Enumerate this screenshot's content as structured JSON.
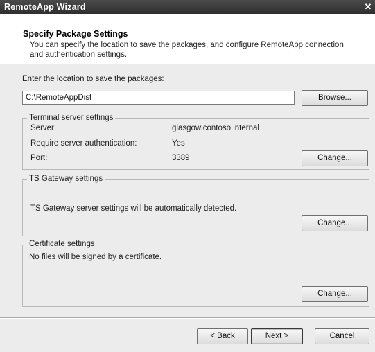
{
  "window": {
    "title": "RemoteApp Wizard",
    "close_glyph": "✕"
  },
  "header": {
    "title": "Specify Package Settings",
    "description": "You can specify the location to save the packages, and configure RemoteApp connection and authentication settings."
  },
  "location": {
    "label": "Enter the location to save the packages:",
    "value": "C:\\RemoteAppDist",
    "browse_label": "Browse..."
  },
  "terminal_server": {
    "legend": "Terminal server settings",
    "rows": [
      {
        "label": "Server:",
        "value": "glasgow.contoso.internal"
      },
      {
        "label": "Require server authentication:",
        "value": "Yes"
      },
      {
        "label": "Port:",
        "value": "3389"
      }
    ],
    "change_label": "Change..."
  },
  "ts_gateway": {
    "legend": "TS Gateway settings",
    "text": "TS Gateway server settings will be automatically detected.",
    "change_label": "Change..."
  },
  "certificate": {
    "legend": "Certificate settings",
    "text": "No files will be signed by a certificate.",
    "change_label": "Change..."
  },
  "footer": {
    "back_label": "< Back",
    "next_label": "Next >",
    "cancel_label": "Cancel"
  }
}
